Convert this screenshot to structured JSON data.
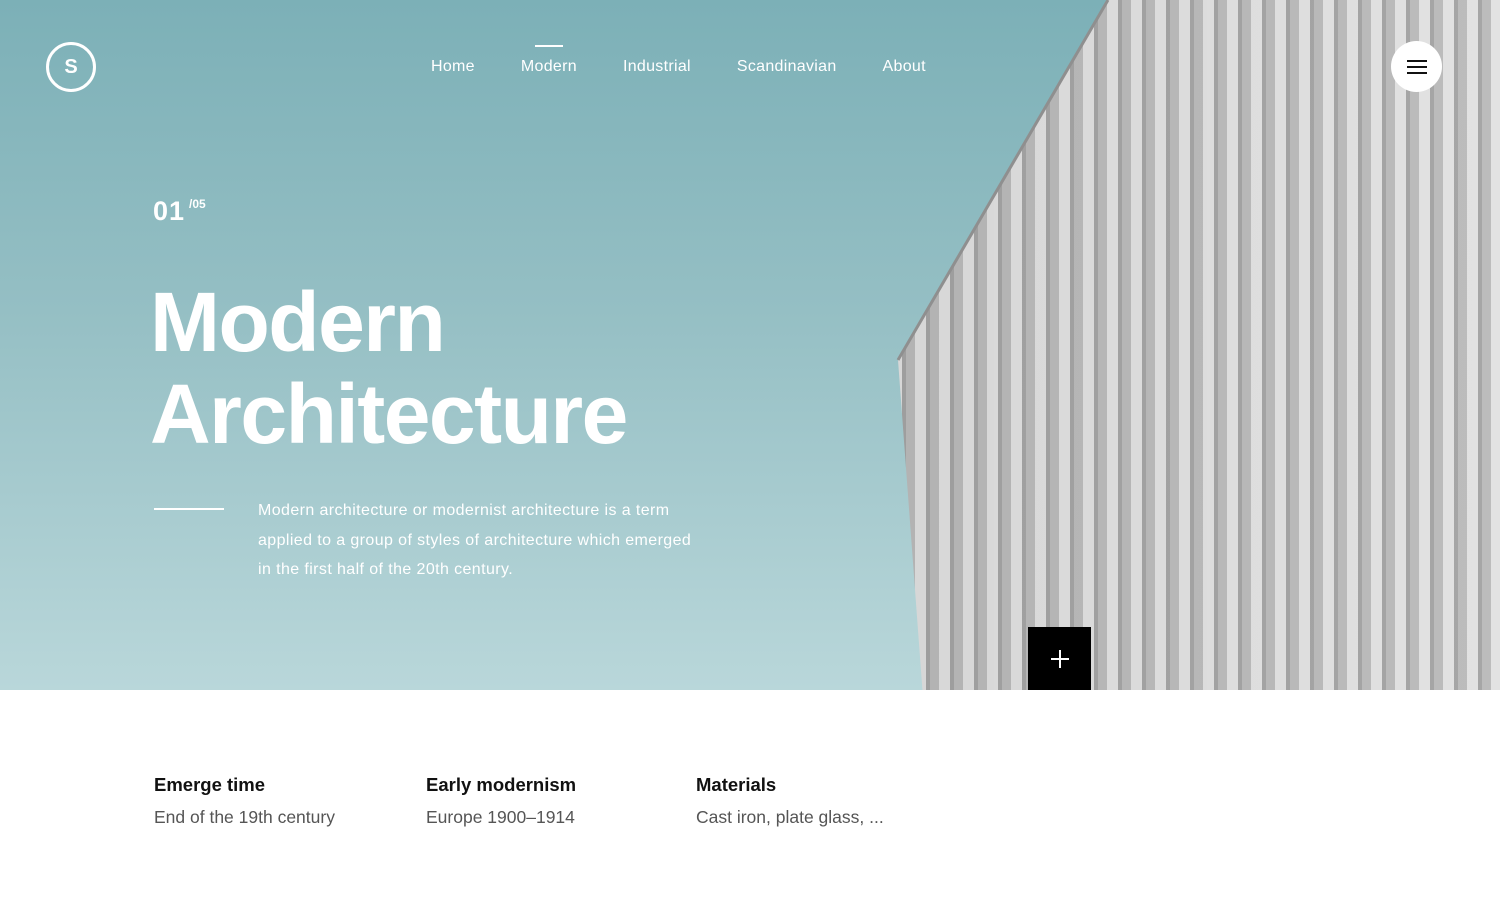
{
  "logo": {
    "letter": "S"
  },
  "nav": {
    "items": [
      {
        "label": "Home",
        "active": false
      },
      {
        "label": "Modern",
        "active": true
      },
      {
        "label": "Industrial",
        "active": false
      },
      {
        "label": "Scandinavian",
        "active": false
      },
      {
        "label": "About",
        "active": false
      }
    ]
  },
  "menu_icon": "hamburger-icon",
  "hero": {
    "slide_current": "01",
    "slide_total": "/05",
    "title_line1": "Modern",
    "title_line2": "Architecture",
    "description": "Modern architecture or modernist architecture is a term applied to a group of styles of architecture which emerged in the first half of the 20th century."
  },
  "expand_icon": "plus-icon",
  "info": [
    {
      "label": "Emerge time",
      "value": "End of the 19th century"
    },
    {
      "label": "Early modernism",
      "value": "Europe 1900–1914"
    },
    {
      "label": "Materials",
      "value": "Cast iron, plate glass, ..."
    }
  ],
  "colors": {
    "sky_top": "#7cb0b7",
    "sky_bottom": "#b9d7da",
    "facade": "#c9c9c9",
    "button_dark": "#000000",
    "text_light": "#ffffff"
  }
}
